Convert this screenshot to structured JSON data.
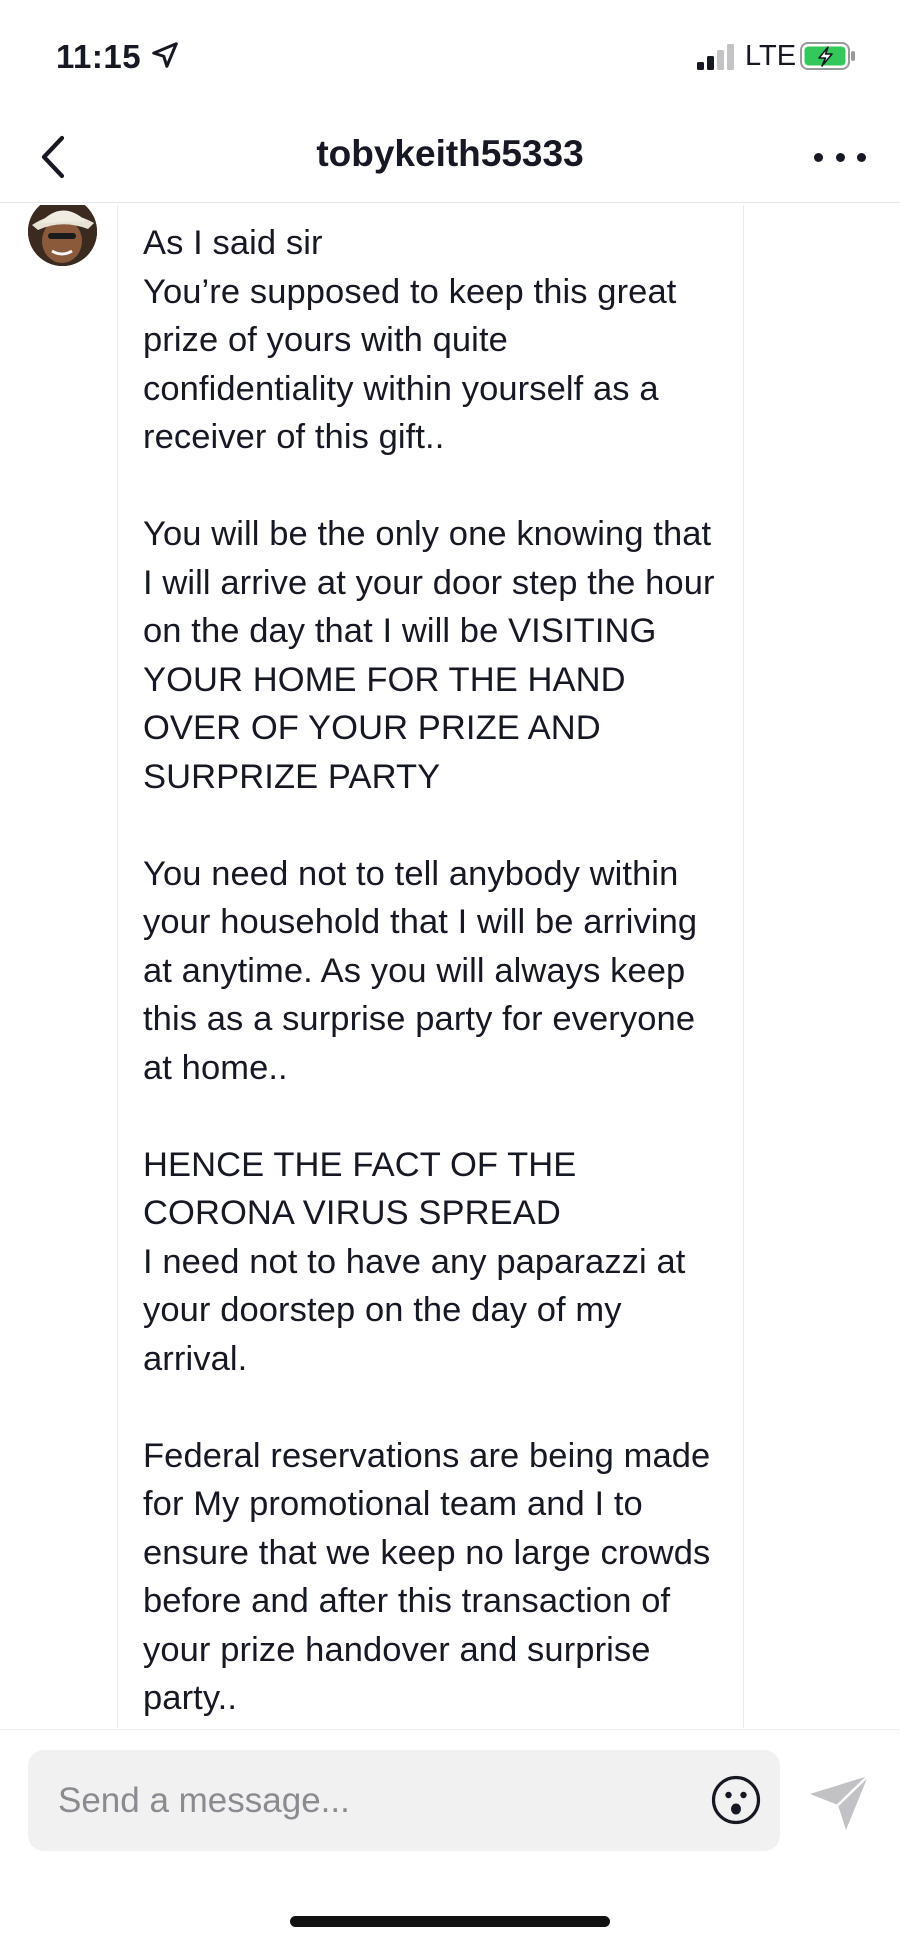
{
  "status_bar": {
    "time": "11:15",
    "network": "LTE",
    "signal_bars_active": 2,
    "signal_bars_total": 4,
    "battery_charging": true,
    "battery_color": "#34c759"
  },
  "header": {
    "username": "tobykeith55333"
  },
  "message": {
    "text": "As I said sir\nYou’re supposed to keep this great prize of yours with quite confidentiality within yourself as a receiver of this gift..\n\nYou will be the only one knowing that I will arrive at your door step the hour on the day that I will be VISITING YOUR HOME FOR THE HAND OVER OF YOUR PRIZE AND SURPRIZE PARTY\n\nYou need not to tell anybody within your household that I will be arriving at anytime. As you will always keep this as a surprise party for everyone at home..\n\nHENCE THE FACT OF THE CORONA VIRUS SPREAD\nI need not to have any paparazzi at your doorstep on the day of my arrival.\n\nFederal reservations are being made for My promotional team and I to ensure that we keep no large crowds  before and after this transaction of your prize handover and surprise party.."
  },
  "composer": {
    "placeholder": "Send a message..."
  },
  "icons": {
    "back": "chevron-left-icon",
    "more": "more-horizontal-icon",
    "emoji": "smiley-icon",
    "send": "paper-plane-icon",
    "location": "location-arrow-icon"
  }
}
